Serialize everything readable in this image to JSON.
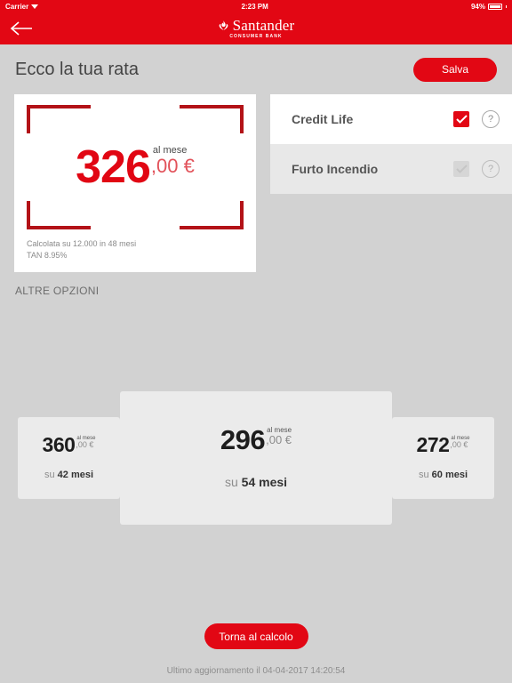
{
  "status_bar": {
    "carrier": "Carrier",
    "wifi_icon": "wifi-icon",
    "time": "2:23 PM",
    "battery_percent": "94%",
    "battery_icon": "battery-icon"
  },
  "navbar": {
    "back_icon": "back-arrow-icon",
    "brand_flame_icon": "santander-flame-icon",
    "brand_name": "Santander",
    "brand_subtitle": "CONSUMER BANK",
    "background_color": "#e20714"
  },
  "header": {
    "title": "Ecco la tua rata",
    "save_label": "Salva"
  },
  "rate_card": {
    "amount": "326",
    "cents": ",00 €",
    "per_month": "al mese",
    "note_line1": "Calcolata su 12.000 in 48 mesi",
    "note_line2": "TAN 8.95%",
    "accent_color": "#e10613",
    "bracket_color": "#b31217"
  },
  "options": {
    "items": [
      {
        "label": "Credit Life",
        "checked": true,
        "enabled": true,
        "check_icon": "check-icon",
        "help_icon": "help-icon"
      },
      {
        "label": "Furto Incendio",
        "checked": false,
        "enabled": false,
        "check_icon": "check-icon",
        "help_icon": "help-icon"
      }
    ]
  },
  "section": {
    "other_options_label": "ALTRE OPZIONI"
  },
  "alternatives": [
    {
      "amount": "360",
      "cents": ",00 €",
      "per_month": "al mese",
      "months_prefix": "su ",
      "months": "42 mesi",
      "selected": false
    },
    {
      "amount": "296",
      "cents": ",00 €",
      "per_month": "al mese",
      "months_prefix": "su ",
      "months": "54 mesi",
      "selected": true
    },
    {
      "amount": "272",
      "cents": ",00 €",
      "per_month": "al mese",
      "months_prefix": "su ",
      "months": "60 mesi",
      "selected": false
    }
  ],
  "footer": {
    "back_to_calc_label": "Torna al calcolo",
    "last_update": "Ultimo aggiornamento il 04-04-2017 14:20:54"
  }
}
